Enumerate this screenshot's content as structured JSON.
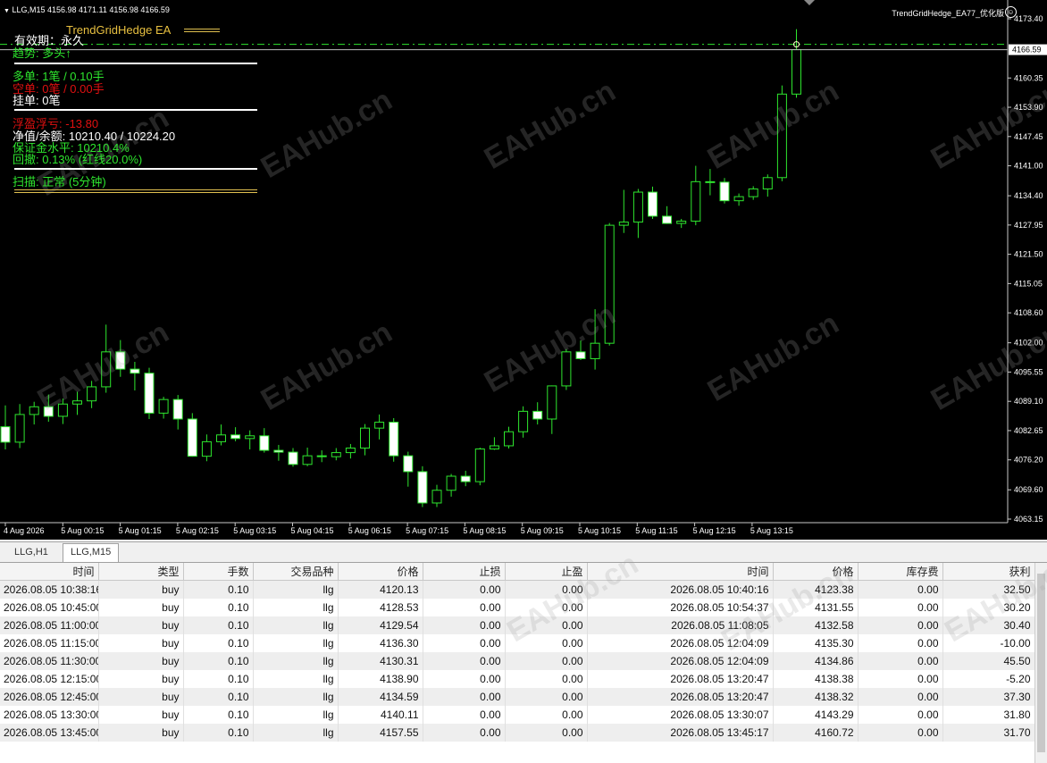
{
  "chart": {
    "symbol_header": "LLG,M15  4156.98 4171.11 4156.98 4166.59",
    "ea_name": "TrendGridHedge_EA77_优化版",
    "ea_title": "TrendGridHedge EA",
    "current_price": "4166.59",
    "price_labels": [
      "4173.40",
      "4166.59",
      "4160.35",
      "4153.90",
      "4147.45",
      "4141.00",
      "4134.40",
      "4127.95",
      "4121.50",
      "4115.05",
      "4108.60",
      "4102.00",
      "4095.55",
      "4089.10",
      "4082.65",
      "4076.20",
      "4069.60",
      "4063.15"
    ],
    "time_labels": [
      "4 Aug 2026",
      "5 Aug 00:15",
      "5 Aug 01:15",
      "5 Aug 02:15",
      "5 Aug 03:15",
      "5 Aug 04:15",
      "5 Aug 06:15",
      "5 Aug 07:15",
      "5 Aug 08:15",
      "5 Aug 09:15",
      "5 Aug 10:15",
      "5 Aug 11:15",
      "5 Aug 12:15",
      "5 Aug 13:15"
    ],
    "ylim": [
      4063.15,
      4173.4
    ],
    "candles": [
      [
        4083.5,
        4088.2,
        4078.5,
        4080.1
      ],
      [
        4080.1,
        4088.5,
        4078.8,
        4086.2
      ],
      [
        4086.2,
        4089.0,
        4084.0,
        4087.9
      ],
      [
        4087.9,
        4090.6,
        4084.6,
        4085.8
      ],
      [
        4085.8,
        4089.7,
        4084.1,
        4088.5
      ],
      [
        4088.5,
        4091.2,
        4086.1,
        4089.2
      ],
      [
        4089.2,
        4093.6,
        4087.6,
        4092.3
      ],
      [
        4092.3,
        4106.0,
        4091.0,
        4100.0
      ],
      [
        4100.0,
        4102.6,
        4094.5,
        4096.2
      ],
      [
        4096.2,
        4097.8,
        4091.5,
        4095.3
      ],
      [
        4095.3,
        4096.5,
        4085.2,
        4086.5
      ],
      [
        4086.5,
        4090.1,
        4085.3,
        4089.5
      ],
      [
        4089.5,
        4090.5,
        4082.9,
        4085.2
      ],
      [
        4085.2,
        4086.5,
        4076.9,
        4077.0
      ],
      [
        4077.0,
        4081.8,
        4075.9,
        4080.2
      ],
      [
        4080.2,
        4084.0,
        4079.4,
        4081.7
      ],
      [
        4081.7,
        4083.4,
        4080.3,
        4080.9
      ],
      [
        4080.9,
        4082.7,
        4078.5,
        4081.5
      ],
      [
        4081.5,
        4083.2,
        4077.8,
        4078.3
      ],
      [
        4078.3,
        4079.5,
        4076.0,
        4077.9
      ],
      [
        4077.9,
        4078.8,
        4074.7,
        4075.2
      ],
      [
        4075.2,
        4078.9,
        4074.8,
        4077.1
      ],
      [
        4077.1,
        4078.3,
        4075.7,
        4076.9
      ],
      [
        4076.9,
        4078.8,
        4076.1,
        4077.8
      ],
      [
        4077.8,
        4079.7,
        4076.5,
        4078.8
      ],
      [
        4078.8,
        4084.1,
        4077.2,
        4083.2
      ],
      [
        4083.2,
        4086.2,
        4080.7,
        4084.5
      ],
      [
        4084.5,
        4085.4,
        4075.8,
        4077.1
      ],
      [
        4077.1,
        4078.0,
        4070.3,
        4073.6
      ],
      [
        4073.6,
        4074.8,
        4065.8,
        4066.7
      ],
      [
        4066.7,
        4070.7,
        4065.8,
        4069.5
      ],
      [
        4069.5,
        4073.1,
        4068.1,
        4072.6
      ],
      [
        4072.6,
        4073.8,
        4070.4,
        4071.4
      ],
      [
        4071.4,
        4078.9,
        4070.6,
        4078.6
      ],
      [
        4078.6,
        4081.2,
        4078.4,
        4079.3
      ],
      [
        4079.3,
        4083.5,
        4078.7,
        4082.4
      ],
      [
        4082.4,
        4088.0,
        4081.1,
        4086.9
      ],
      [
        4086.9,
        4088.9,
        4084.0,
        4085.2
      ],
      [
        4085.2,
        4092.6,
        4081.9,
        4092.5
      ],
      [
        4092.5,
        4100.6,
        4091.6,
        4100.0
      ],
      [
        4100.0,
        4102.5,
        4098.2,
        4098.5
      ],
      [
        4098.5,
        4109.4,
        4096.1,
        4101.9
      ],
      [
        4101.9,
        4128.4,
        4101.4,
        4127.9
      ],
      [
        4127.9,
        4135.7,
        4126.2,
        4128.6
      ],
      [
        4128.6,
        4135.9,
        4125.1,
        4135.2
      ],
      [
        4135.2,
        4136.4,
        4129.3,
        4129.9
      ],
      [
        4129.9,
        4132.1,
        4128.2,
        4128.3
      ],
      [
        4128.3,
        4129.3,
        4127.3,
        4128.8
      ],
      [
        4128.8,
        4141.0,
        4127.9,
        4137.5
      ],
      [
        4137.5,
        4140.3,
        4134.5,
        4137.4
      ],
      [
        4137.4,
        4138.3,
        4132.7,
        4133.3
      ],
      [
        4133.3,
        4134.9,
        4132.2,
        4134.2
      ],
      [
        4134.2,
        4136.5,
        4133.5,
        4135.9
      ],
      [
        4135.9,
        4139.1,
        4134.2,
        4138.4
      ],
      [
        4138.4,
        4158.7,
        4137.6,
        4156.8
      ],
      [
        4156.8,
        4171.1,
        4156.0,
        4166.6
      ]
    ],
    "panel": {
      "validity": "有效期：永久",
      "trend": "趋势: 多头↑",
      "long": "多单: 1笔 / 0.10手",
      "short": "空单: 0笔 / 0.00手",
      "pending": "挂单: 0笔",
      "float_pl_label": "浮盈浮亏: ",
      "float_pl_value": "-13.80",
      "equity": "净值/余额: 10210.40 / 10224.20",
      "margin": "保证金水平: 10210.4%",
      "drawdown": "回撤: 0.13% (红线20.0%)",
      "scan": "扫描: 正常 (5分钟)"
    },
    "watermark": "EAHub.cn",
    "colors": {
      "bull_body": "#000000",
      "bear_body": "#ffffff",
      "candle_outline": "#2ee62e",
      "bid_line": "#bbbbbb",
      "ask_line": "#2ee62e"
    }
  },
  "tabs": [
    "LLG,H1",
    "LLG,M15"
  ],
  "active_tab": "LLG,M15",
  "table": {
    "headers": [
      "时间",
      "类型",
      "手数",
      "交易品种",
      "价格",
      "止损",
      "止盈",
      "时间",
      "价格",
      "库存费",
      "获利"
    ],
    "rows": [
      [
        "2026.08.05 10:38:16",
        "buy",
        "0.10",
        "llg",
        "4120.13",
        "0.00",
        "0.00",
        "2026.08.05 10:40:16",
        "4123.38",
        "0.00",
        "32.50"
      ],
      [
        "2026.08.05 10:45:00",
        "buy",
        "0.10",
        "llg",
        "4128.53",
        "0.00",
        "0.00",
        "2026.08.05 10:54:37",
        "4131.55",
        "0.00",
        "30.20"
      ],
      [
        "2026.08.05 11:00:00",
        "buy",
        "0.10",
        "llg",
        "4129.54",
        "0.00",
        "0.00",
        "2026.08.05 11:08:05",
        "4132.58",
        "0.00",
        "30.40"
      ],
      [
        "2026.08.05 11:15:00",
        "buy",
        "0.10",
        "llg",
        "4136.30",
        "0.00",
        "0.00",
        "2026.08.05 12:04:09",
        "4135.30",
        "0.00",
        "-10.00"
      ],
      [
        "2026.08.05 11:30:00",
        "buy",
        "0.10",
        "llg",
        "4130.31",
        "0.00",
        "0.00",
        "2026.08.05 12:04:09",
        "4134.86",
        "0.00",
        "45.50"
      ],
      [
        "2026.08.05 12:15:00",
        "buy",
        "0.10",
        "llg",
        "4138.90",
        "0.00",
        "0.00",
        "2026.08.05 13:20:47",
        "4138.38",
        "0.00",
        "-5.20"
      ],
      [
        "2026.08.05 12:45:00",
        "buy",
        "0.10",
        "llg",
        "4134.59",
        "0.00",
        "0.00",
        "2026.08.05 13:20:47",
        "4138.32",
        "0.00",
        "37.30"
      ],
      [
        "2026.08.05 13:30:00",
        "buy",
        "0.10",
        "llg",
        "4140.11",
        "0.00",
        "0.00",
        "2026.08.05 13:30:07",
        "4143.29",
        "0.00",
        "31.80"
      ],
      [
        "2026.08.05 13:45:00",
        "buy",
        "0.10",
        "llg",
        "4157.55",
        "0.00",
        "0.00",
        "2026.08.05 13:45:17",
        "4160.72",
        "0.00",
        "31.70"
      ]
    ]
  }
}
